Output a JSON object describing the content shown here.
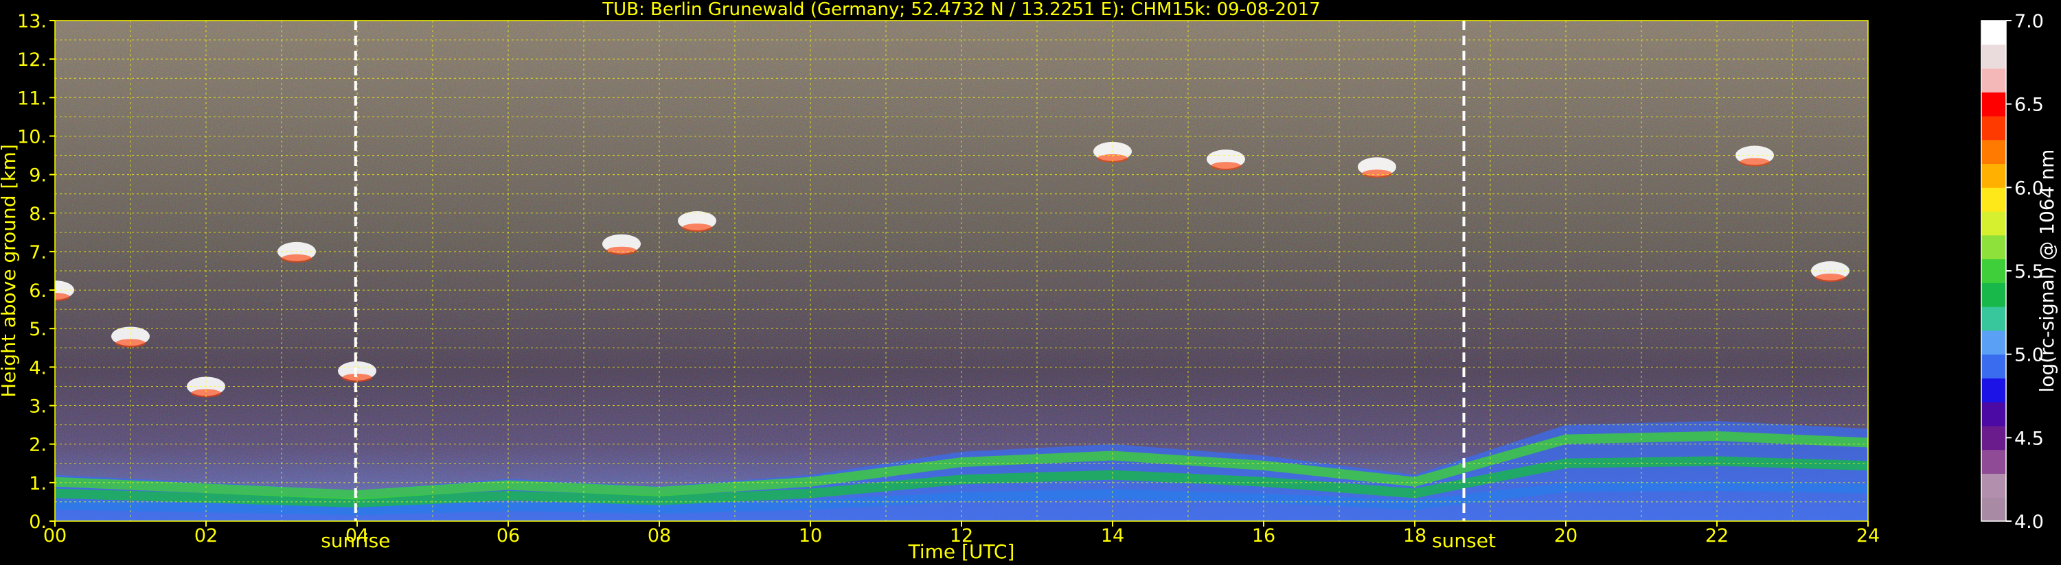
{
  "chart_data": {
    "type": "heatmap",
    "title": "TUB: Berlin Grunewald (Germany; 52.4732 N / 13.2251 E):    CHM15k: 09-08-2017",
    "xlabel": "Time [UTC]",
    "ylabel": "Height above ground [km]",
    "xlim": [
      0,
      24
    ],
    "ylim": [
      0,
      13
    ],
    "xticks": [
      "00",
      "02",
      "04",
      "06",
      "08",
      "10",
      "12",
      "14",
      "16",
      "18",
      "20",
      "22",
      "24"
    ],
    "yticks": [
      "0.",
      "1.",
      "2.",
      "3.",
      "4.",
      "5.",
      "6.",
      "7.",
      "8.",
      "9.",
      "10.",
      "11.",
      "12.",
      "13."
    ],
    "grid": true,
    "annotations": [
      {
        "label": "sunrise",
        "x": 3.98
      },
      {
        "label": "sunset",
        "x": 18.65
      }
    ],
    "colorbar": {
      "label": "log(rc-signal) @ 1064 nm",
      "range": [
        4.0,
        7.0
      ],
      "ticks": [
        "4.0",
        "4.5",
        "5.0",
        "5.5",
        "6.0",
        "6.5",
        "7.0"
      ],
      "colors": [
        "#a98aa4",
        "#b38fae",
        "#8f4b96",
        "#6a1c8c",
        "#4a0aa3",
        "#1c14e6",
        "#3a6cf0",
        "#5aa0f5",
        "#38c69c",
        "#18b84a",
        "#3fcf3a",
        "#8ee03a",
        "#d6ef2e",
        "#ffe81a",
        "#ffb000",
        "#ff7a00",
        "#ff3a00",
        "#ff0000",
        "#f4b8b8",
        "#eadcdc",
        "#ffffff"
      ]
    },
    "layers": [
      {
        "name": "boundary-layer",
        "x": [
          0,
          2,
          4,
          6,
          8,
          10,
          12,
          14,
          16,
          18,
          20,
          22,
          24
        ],
        "y": [
          1.2,
          1.0,
          0.8,
          1.1,
          0.9,
          1.2,
          1.8,
          2.0,
          1.7,
          1.2,
          2.5,
          2.6,
          2.4
        ]
      },
      {
        "name": "cloud-base",
        "x": [
          0.0,
          1.0,
          2.0,
          3.2,
          4.0,
          7.5,
          8.5,
          14.0,
          15.5,
          17.5,
          22.5,
          23.5
        ],
        "y": [
          6.0,
          4.8,
          3.5,
          7.0,
          3.9,
          7.2,
          7.8,
          9.6,
          9.4,
          9.2,
          9.5,
          6.5
        ]
      }
    ]
  }
}
